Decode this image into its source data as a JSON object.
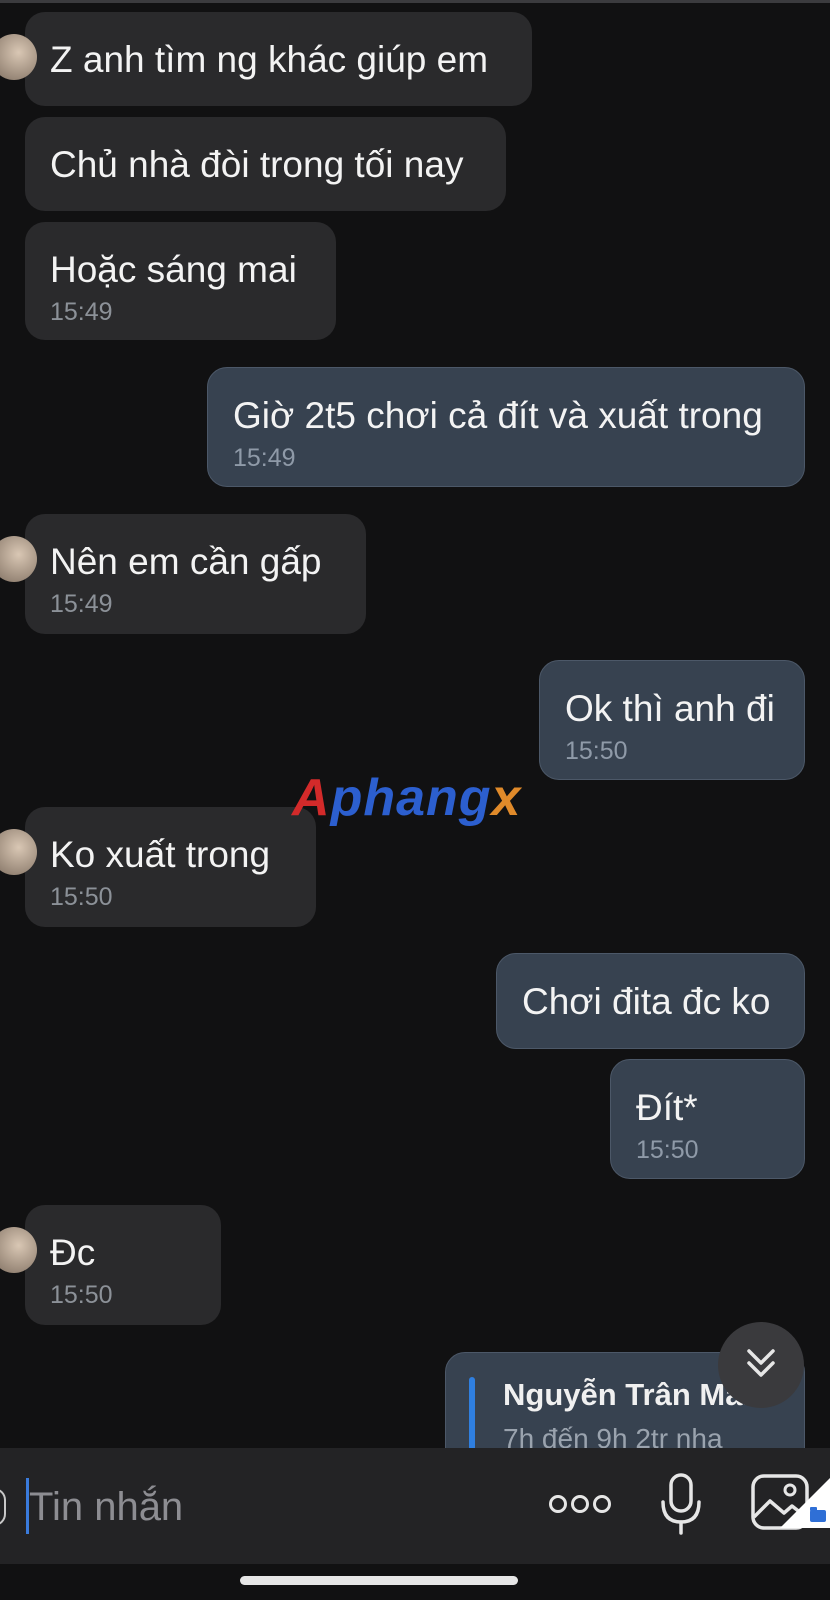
{
  "messages": [
    {
      "text": "Z anh tìm ng khác giúp em",
      "time": ""
    },
    {
      "text": "Chủ nhà đòi trong tối nay",
      "time": ""
    },
    {
      "text": "Hoặc sáng mai",
      "time": "15:49"
    },
    {
      "text": "Giờ 2t5 chơi cả đít và xuất trong",
      "time": "15:49"
    },
    {
      "text": "Nên em cần gấp",
      "time": "15:49"
    },
    {
      "text": "Ok thì anh đi",
      "time": "15:50"
    },
    {
      "text": "Ko xuất trong",
      "time": "15:50"
    },
    {
      "text": "Chơi đita đc ko",
      "time": ""
    },
    {
      "text": "Đít*",
      "time": "15:50"
    },
    {
      "text": "Đc",
      "time": "15:50"
    }
  ],
  "reply_preview": {
    "name": "Nguyễn Trân Mẫn",
    "text": "7h đến 9h  2tr nha"
  },
  "watermark": {
    "part1": "A",
    "part2": "phang",
    "part3": "x"
  },
  "composer": {
    "placeholder": "Tin nhắn"
  },
  "icons": {
    "scroll": "double-chevron-down-icon",
    "more": "more-dots-icon",
    "mic": "microphone-icon",
    "image": "image-gallery-icon"
  },
  "colors": {
    "background": "#111112",
    "incoming_bubble": "#2a2a2c",
    "outgoing_bubble": "#374250",
    "accent": "#2f7fe0"
  }
}
